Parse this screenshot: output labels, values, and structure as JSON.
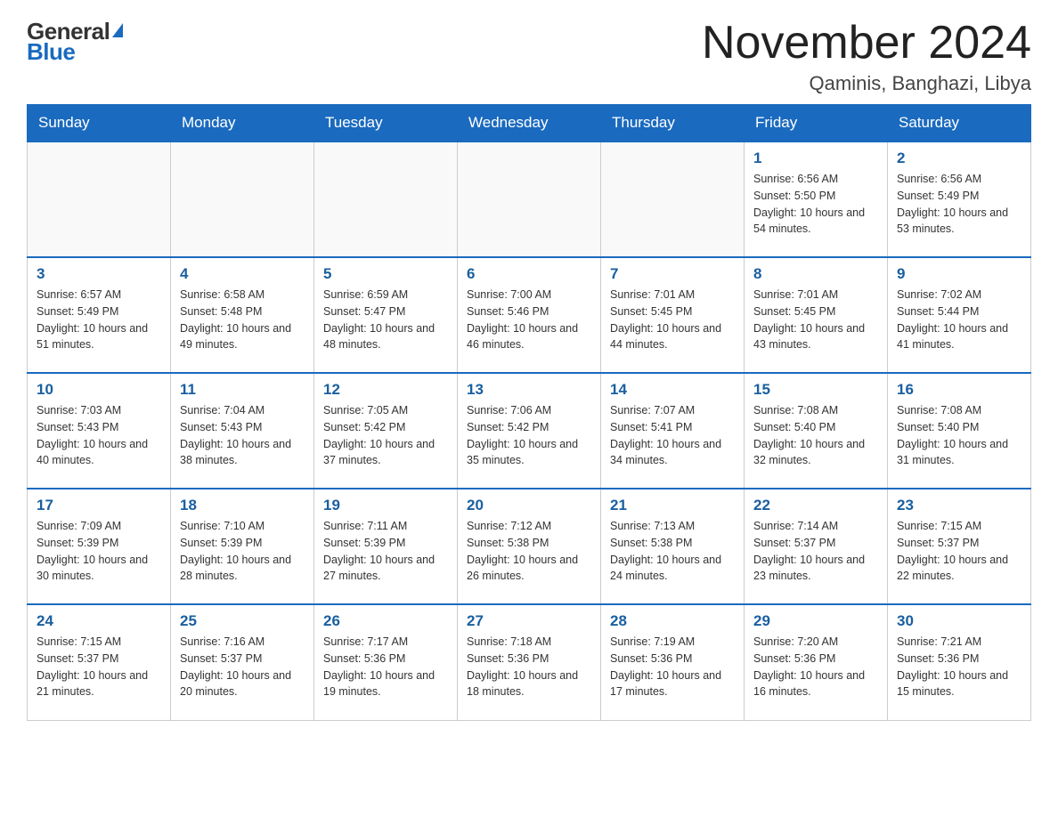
{
  "header": {
    "logo_general": "General",
    "logo_blue": "Blue",
    "month_title": "November 2024",
    "location": "Qaminis, Banghazi, Libya"
  },
  "days_of_week": [
    "Sunday",
    "Monday",
    "Tuesday",
    "Wednesday",
    "Thursday",
    "Friday",
    "Saturday"
  ],
  "weeks": [
    [
      {
        "day": "",
        "info": ""
      },
      {
        "day": "",
        "info": ""
      },
      {
        "day": "",
        "info": ""
      },
      {
        "day": "",
        "info": ""
      },
      {
        "day": "",
        "info": ""
      },
      {
        "day": "1",
        "info": "Sunrise: 6:56 AM\nSunset: 5:50 PM\nDaylight: 10 hours and 54 minutes."
      },
      {
        "day": "2",
        "info": "Sunrise: 6:56 AM\nSunset: 5:49 PM\nDaylight: 10 hours and 53 minutes."
      }
    ],
    [
      {
        "day": "3",
        "info": "Sunrise: 6:57 AM\nSunset: 5:49 PM\nDaylight: 10 hours and 51 minutes."
      },
      {
        "day": "4",
        "info": "Sunrise: 6:58 AM\nSunset: 5:48 PM\nDaylight: 10 hours and 49 minutes."
      },
      {
        "day": "5",
        "info": "Sunrise: 6:59 AM\nSunset: 5:47 PM\nDaylight: 10 hours and 48 minutes."
      },
      {
        "day": "6",
        "info": "Sunrise: 7:00 AM\nSunset: 5:46 PM\nDaylight: 10 hours and 46 minutes."
      },
      {
        "day": "7",
        "info": "Sunrise: 7:01 AM\nSunset: 5:45 PM\nDaylight: 10 hours and 44 minutes."
      },
      {
        "day": "8",
        "info": "Sunrise: 7:01 AM\nSunset: 5:45 PM\nDaylight: 10 hours and 43 minutes."
      },
      {
        "day": "9",
        "info": "Sunrise: 7:02 AM\nSunset: 5:44 PM\nDaylight: 10 hours and 41 minutes."
      }
    ],
    [
      {
        "day": "10",
        "info": "Sunrise: 7:03 AM\nSunset: 5:43 PM\nDaylight: 10 hours and 40 minutes."
      },
      {
        "day": "11",
        "info": "Sunrise: 7:04 AM\nSunset: 5:43 PM\nDaylight: 10 hours and 38 minutes."
      },
      {
        "day": "12",
        "info": "Sunrise: 7:05 AM\nSunset: 5:42 PM\nDaylight: 10 hours and 37 minutes."
      },
      {
        "day": "13",
        "info": "Sunrise: 7:06 AM\nSunset: 5:42 PM\nDaylight: 10 hours and 35 minutes."
      },
      {
        "day": "14",
        "info": "Sunrise: 7:07 AM\nSunset: 5:41 PM\nDaylight: 10 hours and 34 minutes."
      },
      {
        "day": "15",
        "info": "Sunrise: 7:08 AM\nSunset: 5:40 PM\nDaylight: 10 hours and 32 minutes."
      },
      {
        "day": "16",
        "info": "Sunrise: 7:08 AM\nSunset: 5:40 PM\nDaylight: 10 hours and 31 minutes."
      }
    ],
    [
      {
        "day": "17",
        "info": "Sunrise: 7:09 AM\nSunset: 5:39 PM\nDaylight: 10 hours and 30 minutes."
      },
      {
        "day": "18",
        "info": "Sunrise: 7:10 AM\nSunset: 5:39 PM\nDaylight: 10 hours and 28 minutes."
      },
      {
        "day": "19",
        "info": "Sunrise: 7:11 AM\nSunset: 5:39 PM\nDaylight: 10 hours and 27 minutes."
      },
      {
        "day": "20",
        "info": "Sunrise: 7:12 AM\nSunset: 5:38 PM\nDaylight: 10 hours and 26 minutes."
      },
      {
        "day": "21",
        "info": "Sunrise: 7:13 AM\nSunset: 5:38 PM\nDaylight: 10 hours and 24 minutes."
      },
      {
        "day": "22",
        "info": "Sunrise: 7:14 AM\nSunset: 5:37 PM\nDaylight: 10 hours and 23 minutes."
      },
      {
        "day": "23",
        "info": "Sunrise: 7:15 AM\nSunset: 5:37 PM\nDaylight: 10 hours and 22 minutes."
      }
    ],
    [
      {
        "day": "24",
        "info": "Sunrise: 7:15 AM\nSunset: 5:37 PM\nDaylight: 10 hours and 21 minutes."
      },
      {
        "day": "25",
        "info": "Sunrise: 7:16 AM\nSunset: 5:37 PM\nDaylight: 10 hours and 20 minutes."
      },
      {
        "day": "26",
        "info": "Sunrise: 7:17 AM\nSunset: 5:36 PM\nDaylight: 10 hours and 19 minutes."
      },
      {
        "day": "27",
        "info": "Sunrise: 7:18 AM\nSunset: 5:36 PM\nDaylight: 10 hours and 18 minutes."
      },
      {
        "day": "28",
        "info": "Sunrise: 7:19 AM\nSunset: 5:36 PM\nDaylight: 10 hours and 17 minutes."
      },
      {
        "day": "29",
        "info": "Sunrise: 7:20 AM\nSunset: 5:36 PM\nDaylight: 10 hours and 16 minutes."
      },
      {
        "day": "30",
        "info": "Sunrise: 7:21 AM\nSunset: 5:36 PM\nDaylight: 10 hours and 15 minutes."
      }
    ]
  ]
}
